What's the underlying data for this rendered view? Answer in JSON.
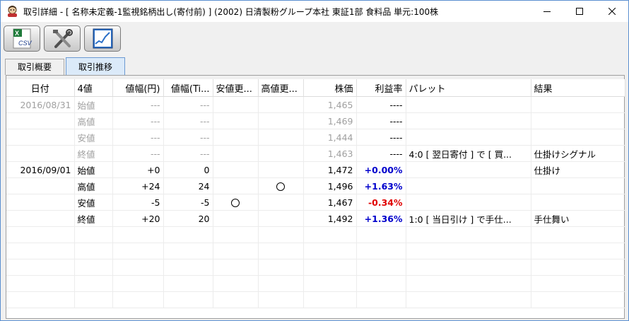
{
  "window": {
    "title": "取引詳細 - [ 名称未定義-1監視銘柄出し(寄付前) ] (2002) 日清製粉グループ本社 東証1部 食料品 単元:100株",
    "controls": [
      "minimize-icon",
      "maximize-icon",
      "close-icon"
    ]
  },
  "toolbar": {
    "buttons": [
      {
        "icon": "csv-export-icon",
        "label": "CSV"
      },
      {
        "icon": "settings-tools-icon"
      },
      {
        "icon": "chart-icon"
      }
    ]
  },
  "tabs": [
    {
      "label": "取引概要",
      "active": false
    },
    {
      "label": "取引推移",
      "active": true
    }
  ],
  "table": {
    "headers": [
      "日付",
      "4値",
      "値幅(円)",
      "値幅(Ti...",
      "安値更...",
      "高値更...",
      "株価",
      "利益率",
      "パレット",
      "結果"
    ],
    "rows": [
      {
        "date": "2016/08/31",
        "kind": "始値",
        "yen": "---",
        "ti": "---",
        "low": "",
        "high": "",
        "price": "1,465",
        "rate": "----",
        "rate_type": "none",
        "palette": "",
        "result": "",
        "gray": true
      },
      {
        "date": "",
        "kind": "高値",
        "yen": "---",
        "ti": "---",
        "low": "",
        "high": "",
        "price": "1,469",
        "rate": "----",
        "rate_type": "none",
        "palette": "",
        "result": "",
        "gray": true
      },
      {
        "date": "",
        "kind": "安値",
        "yen": "---",
        "ti": "---",
        "low": "",
        "high": "",
        "price": "1,444",
        "rate": "----",
        "rate_type": "none",
        "palette": "",
        "result": "",
        "gray": true
      },
      {
        "date": "",
        "kind": "終値",
        "yen": "---",
        "ti": "---",
        "low": "",
        "high": "",
        "price": "1,463",
        "rate": "----",
        "rate_type": "none",
        "palette": "4:0 [ 翌日寄付 ] で [ 買...",
        "result": "仕掛けシグナル",
        "gray": true
      },
      {
        "date": "2016/09/01",
        "kind": "始値",
        "yen": "+0",
        "ti": "0",
        "low": "",
        "high": "",
        "price": "1,472",
        "rate": "+0.00%",
        "rate_type": "pos",
        "palette": "",
        "result": "仕掛け",
        "gray": false
      },
      {
        "date": "",
        "kind": "高値",
        "yen": "+24",
        "ti": "24",
        "low": "",
        "high": "○",
        "price": "1,496",
        "rate": "+1.63%",
        "rate_type": "pos",
        "palette": "",
        "result": "",
        "gray": false
      },
      {
        "date": "",
        "kind": "安値",
        "yen": "-5",
        "ti": "-5",
        "low": "○",
        "high": "",
        "price": "1,467",
        "rate": "-0.34%",
        "rate_type": "neg",
        "palette": "",
        "result": "",
        "gray": false
      },
      {
        "date": "",
        "kind": "終値",
        "yen": "+20",
        "ti": "20",
        "low": "",
        "high": "",
        "price": "1,492",
        "rate": "+1.36%",
        "rate_type": "pos",
        "palette": "1:0 [ 当日引け ] で手仕...",
        "result": "手仕舞い",
        "gray": false
      }
    ],
    "empty_rows": 5
  }
}
